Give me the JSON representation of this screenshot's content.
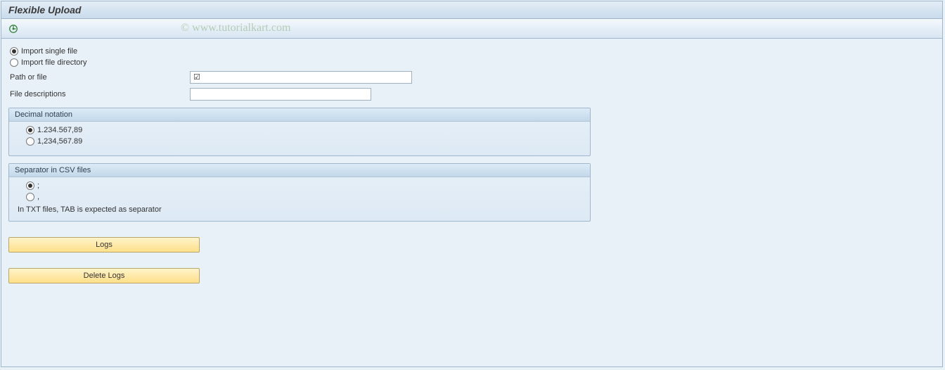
{
  "header": {
    "title": "Flexible Upload"
  },
  "watermark": "© www.tutorialkart.com",
  "options": {
    "single_file": "Import single file",
    "directory": "Import file directory"
  },
  "fields": {
    "path_label": "Path or file",
    "path_value": "",
    "path_checked_glyph": "☑",
    "desc_label": "File descriptions",
    "desc_value": ""
  },
  "decimal_group": {
    "title": "Decimal notation",
    "opt1": "1.234.567,89",
    "opt2": "1,234,567.89"
  },
  "separator_group": {
    "title": "Separator in CSV files",
    "opt1": ";",
    "opt2": ",",
    "note": "In TXT files, TAB is expected as separator"
  },
  "buttons": {
    "logs": "Logs",
    "delete_logs": "Delete Logs"
  }
}
